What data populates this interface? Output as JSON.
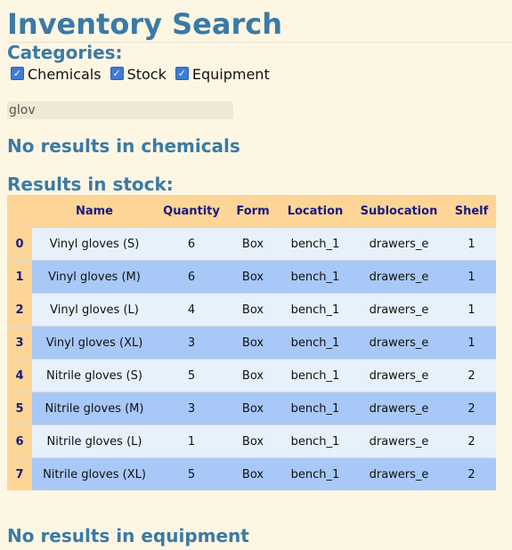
{
  "page": {
    "title": "Inventory Search",
    "categories_label": "Categories:"
  },
  "categories": [
    {
      "label": "Chemicals",
      "checked": true
    },
    {
      "label": "Stock",
      "checked": true
    },
    {
      "label": "Equipment",
      "checked": true
    }
  ],
  "search": {
    "value": "glov"
  },
  "messages": {
    "chemicals": "No results in chemicals",
    "stock": "Results in stock:",
    "equipment": "No results in equipment"
  },
  "table": {
    "columns": [
      "Name",
      "Quantity",
      "Form",
      "Location",
      "Sublocation",
      "Shelf"
    ],
    "rows": [
      {
        "index": "0",
        "name": "Vinyl gloves (S)",
        "quantity": "6",
        "form": "Box",
        "location": "bench_1",
        "sublocation": "drawers_e",
        "shelf": "1"
      },
      {
        "index": "1",
        "name": "Vinyl gloves (M)",
        "quantity": "6",
        "form": "Box",
        "location": "bench_1",
        "sublocation": "drawers_e",
        "shelf": "1"
      },
      {
        "index": "2",
        "name": "Vinyl gloves (L)",
        "quantity": "4",
        "form": "Box",
        "location": "bench_1",
        "sublocation": "drawers_e",
        "shelf": "1"
      },
      {
        "index": "3",
        "name": "Vinyl gloves (XL)",
        "quantity": "3",
        "form": "Box",
        "location": "bench_1",
        "sublocation": "drawers_e",
        "shelf": "1"
      },
      {
        "index": "4",
        "name": "Nitrile gloves (S)",
        "quantity": "5",
        "form": "Box",
        "location": "bench_1",
        "sublocation": "drawers_e",
        "shelf": "2"
      },
      {
        "index": "5",
        "name": "Nitrile gloves (M)",
        "quantity": "3",
        "form": "Box",
        "location": "bench_1",
        "sublocation": "drawers_e",
        "shelf": "2"
      },
      {
        "index": "6",
        "name": "Nitrile gloves (L)",
        "quantity": "1",
        "form": "Box",
        "location": "bench_1",
        "sublocation": "drawers_e",
        "shelf": "2"
      },
      {
        "index": "7",
        "name": "Nitrile gloves (XL)",
        "quantity": "5",
        "form": "Box",
        "location": "bench_1",
        "sublocation": "drawers_e",
        "shelf": "2"
      }
    ]
  }
}
